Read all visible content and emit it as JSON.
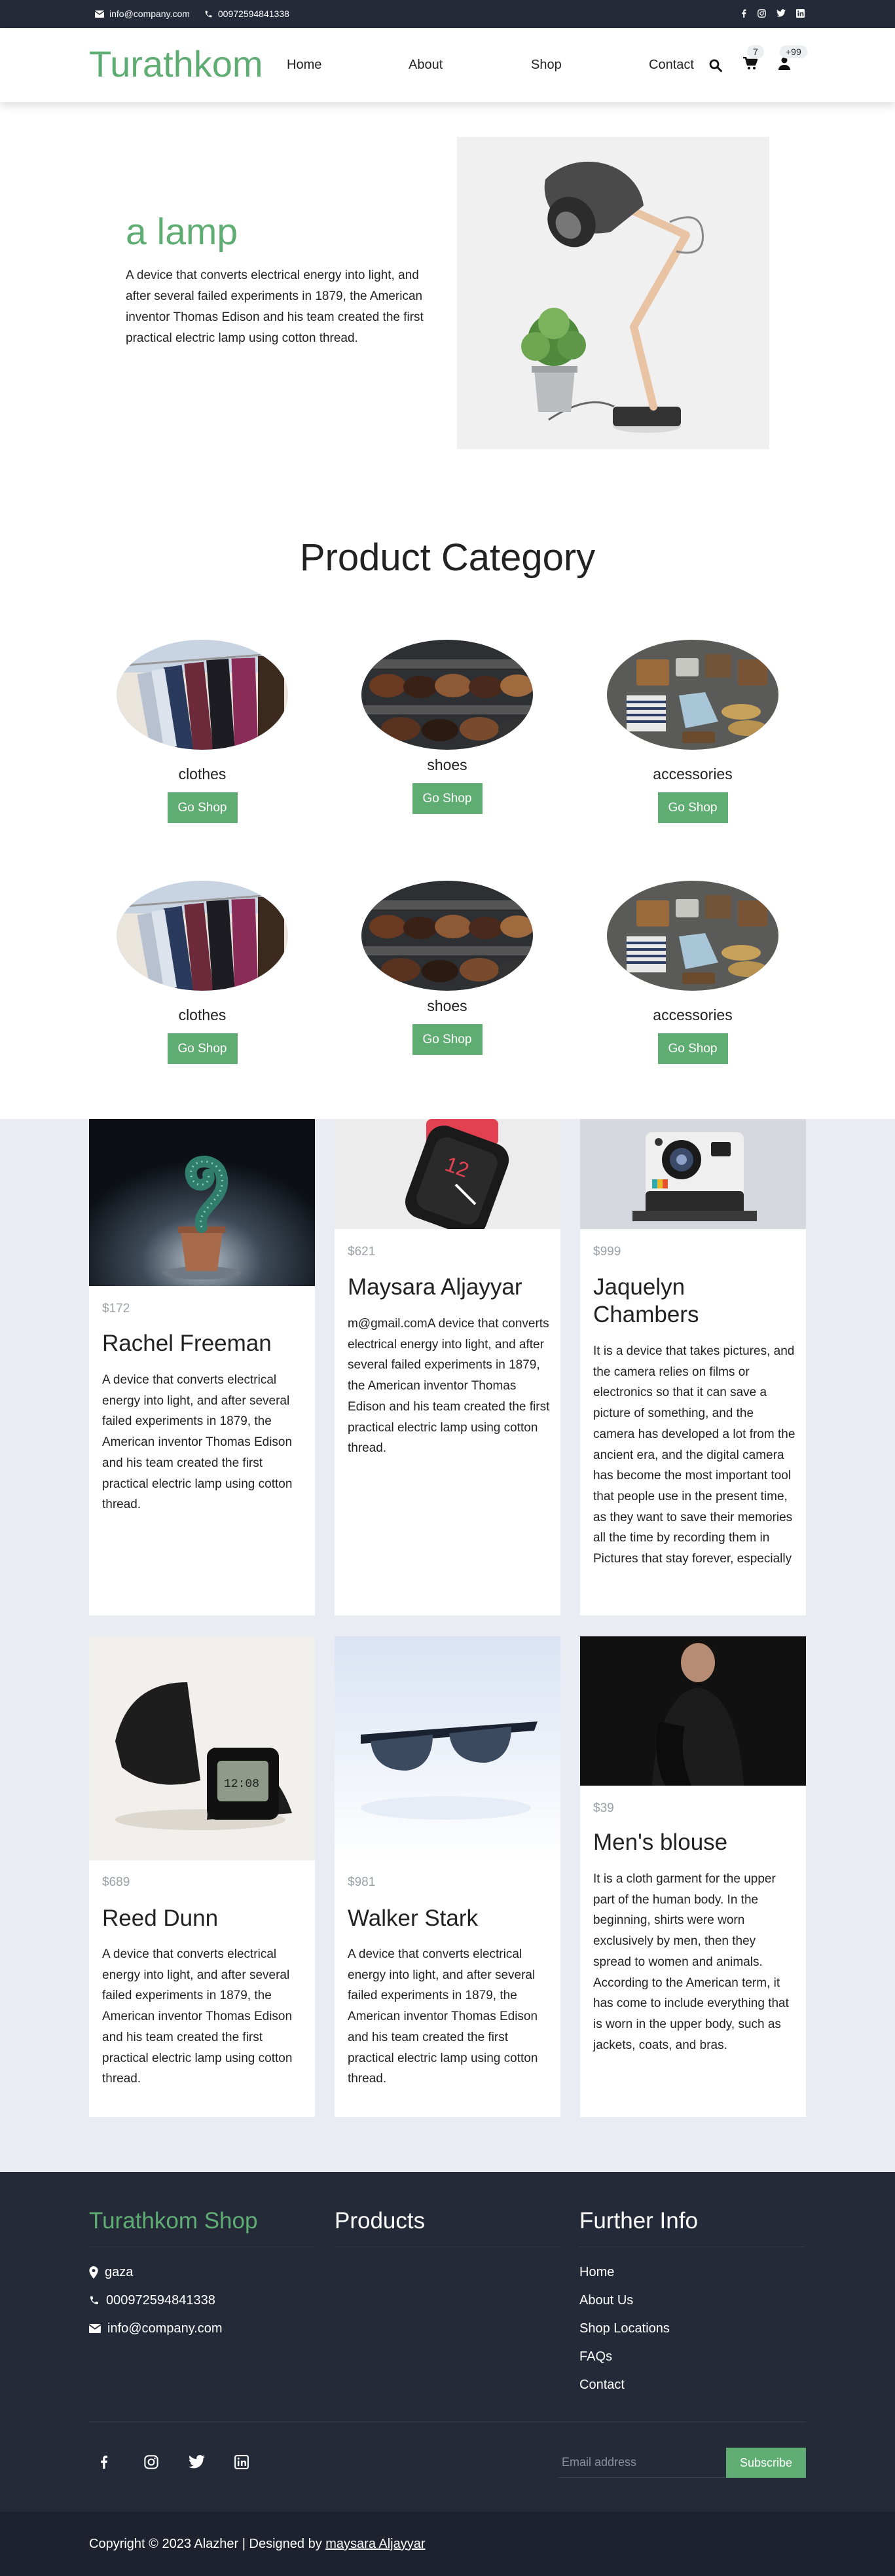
{
  "topbar": {
    "email": "info@company.com",
    "phone": "00972594841338",
    "social_icons": [
      "facebook-icon",
      "instagram-icon",
      "twitter-icon",
      "linkedin-icon"
    ]
  },
  "header": {
    "logo": "Turathkom",
    "nav": [
      "Home",
      "About",
      "Shop",
      "Contact"
    ],
    "cart_count": "7",
    "user_badge": "+99"
  },
  "hero": {
    "title": "a lamp",
    "text": "A device that converts electrical energy into light, and after several failed experiments in 1879, the American inventor Thomas Edison and his team created the first practical electric lamp using cotton thread."
  },
  "categories": {
    "title": "Product Category",
    "items": [
      {
        "label": "clothes",
        "button": "Go Shop"
      },
      {
        "label": "shoes",
        "button": "Go Shop"
      },
      {
        "label": "accessories",
        "button": "Go Shop"
      },
      {
        "label": "clothes",
        "button": "Go Shop"
      },
      {
        "label": "shoes",
        "button": "Go Shop"
      },
      {
        "label": "accessories",
        "button": "Go Shop"
      }
    ]
  },
  "products": [
    {
      "price": "$172",
      "name": "Rachel Freeman",
      "desc": "A device that converts electrical energy into light, and after several failed experiments in 1879, the American inventor Thomas Edison and his team created the first practical electric lamp using cotton thread."
    },
    {
      "price": "$621",
      "name": "Maysara Aljayyar",
      "desc": "m@gmail.comA device that converts electrical energy into light, and after several failed experiments in 1879, the American inventor Thomas Edison and his team created the first practical electric lamp using cotton thread."
    },
    {
      "price": "$999",
      "name": "Jaquelyn Chambers",
      "desc": "It is a device that takes pictures, and the camera relies on films or electronics so that it can save a picture of something, and the camera has developed a lot from the ancient era, and the digital camera has become the most important tool that people use in the present time, as they want to save their memories all the time by recording them in Pictures that stay forever, especially"
    },
    {
      "price": "$689",
      "name": "Reed Dunn",
      "desc": "A device that converts electrical energy into light, and after several failed experiments in 1879, the American inventor Thomas Edison and his team created the first practical electric lamp using cotton thread."
    },
    {
      "price": "$981",
      "name": "Walker Stark",
      "desc": "A device that converts electrical energy into light, and after several failed experiments in 1879, the American inventor Thomas Edison and his team created the first practical electric lamp using cotton thread."
    },
    {
      "price": "$39",
      "name": "Men's blouse",
      "desc": "It is a cloth garment for the upper part of the human body. In the beginning, shirts were worn exclusively by men, then they spread to women and animals. According to the American term, it has come to include everything that is worn in the upper body, such as jackets, coats, and bras."
    }
  ],
  "footer": {
    "brand": "Turathkom Shop",
    "products_heading": "Products",
    "further_heading": "Further Info",
    "location": "gaza",
    "phone": "000972594841338",
    "email": "info@company.com",
    "links": [
      "Home",
      "About Us",
      "Shop Locations",
      "FAQs",
      "Contact"
    ],
    "social_icons": [
      "facebook-icon",
      "instagram-icon",
      "twitter-icon",
      "linkedin-icon"
    ],
    "email_placeholder": "Email address",
    "subscribe": "Subscribe"
  },
  "copyright": {
    "text": "Copyright © 2023 Alazher | Designed by ",
    "author": "maysara Aljayyar"
  },
  "colors": {
    "accent": "#5fad73",
    "dark": "#242a37",
    "darker": "#1e222e",
    "section_bg": "#e9ecf2"
  }
}
